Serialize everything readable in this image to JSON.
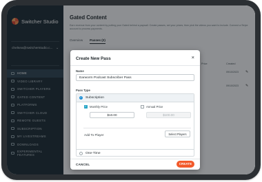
{
  "app": {
    "name": "Switcher Studio"
  },
  "sidebar": {
    "account": "chelsea@switcherstudio.c...",
    "account_chevron": "⌄",
    "items": [
      {
        "label": "HOME",
        "icon": "home-icon"
      },
      {
        "label": "VIDEO LIBRARY",
        "icon": "video-library-icon"
      },
      {
        "label": "SWITCHER PLAYERS",
        "icon": "player-icon"
      },
      {
        "label": "GATED CONTENT",
        "icon": "gated-content-icon"
      },
      {
        "label": "PLATFORMS",
        "icon": "platforms-icon"
      },
      {
        "label": "SWITCHER CLOUD",
        "icon": "cloud-icon"
      },
      {
        "label": "REMOTE GUESTS",
        "icon": "remote-guests-icon"
      },
      {
        "label": "SUBSCRIPTION",
        "icon": "subscription-icon"
      },
      {
        "label": "MY LIVESTREAMS",
        "icon": "livestreams-icon"
      },
      {
        "label": "DOWNLOADS",
        "icon": "downloads-icon"
      },
      {
        "label": "EXPERIMENTAL",
        "label2": "FEATURES",
        "icon": "experimental-icon"
      }
    ]
  },
  "main": {
    "title": "Gated Content",
    "description": "Earn revenue from your content by putting your Gated behind a paywall. Create passes, set your prices, then pick the videos you want to include. Connect a Stripe account to process payments.",
    "tabs": [
      {
        "label": "Overview",
        "active": false
      },
      {
        "label": "Passes (2)",
        "active": true
      }
    ],
    "col_header_price": "Price",
    "col_header_created": "Created",
    "rows": [
      {
        "created": "09/10/2023"
      },
      {
        "created": "09/10/2023"
      }
    ]
  },
  "modal": {
    "title": "Create New Pass",
    "close": "×",
    "name_label": "Name",
    "name_value": "Earworm Podcast Subscriber Pass",
    "pass_type_label": "Pass Type",
    "subscription_label": "Subscription",
    "monthly_price_label": "Monthly Price",
    "monthly_price_value": "$10.00",
    "annual_price_label": "Annual Price",
    "annual_price_placeholder": "$100.00",
    "add_to_player_label": "Add To Player",
    "select_players_label": "Select Players",
    "one_time_label": "One-Time",
    "cancel_label": "CANCEL",
    "create_label": "CREATE"
  },
  "colors": {
    "sidebar_bg": "#1d2b33",
    "accent_create": "#f25a2b",
    "checkbox_on": "#2aa6c7",
    "radio_on": "#1f8fd6"
  }
}
